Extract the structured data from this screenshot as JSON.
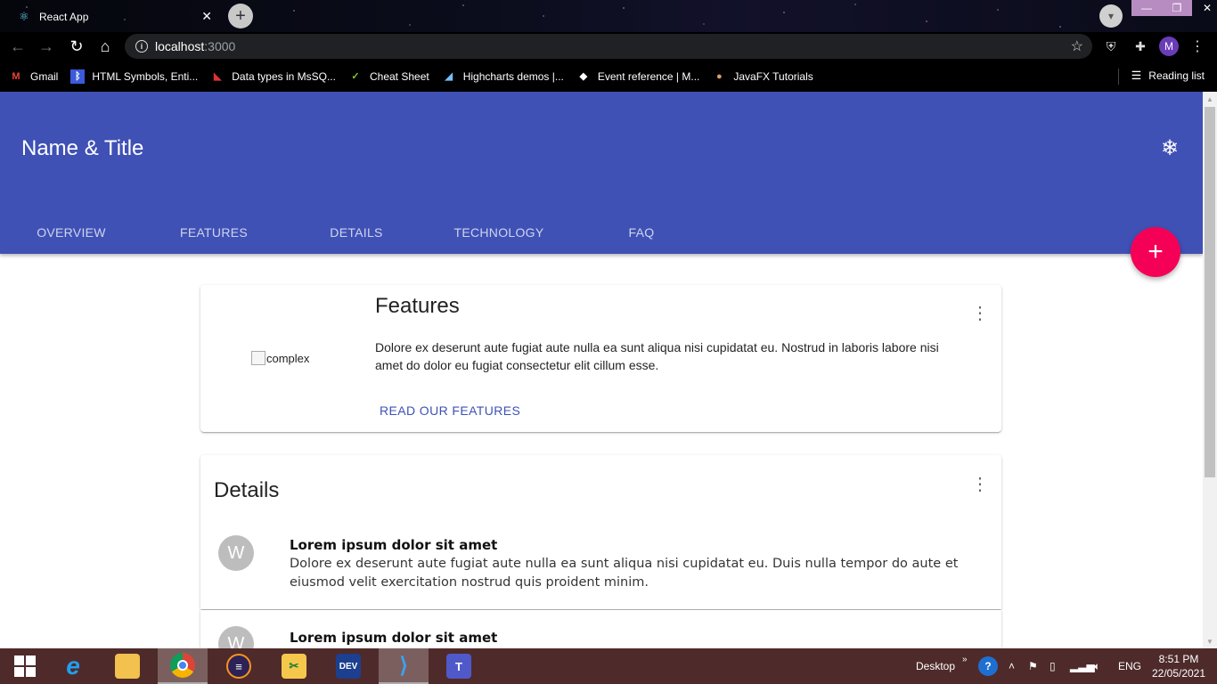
{
  "browser": {
    "tab_title": "React App",
    "tab_close": "✕",
    "new_tab": "+",
    "url_host": "localhost",
    "url_port": ":3000",
    "bookmarks": [
      {
        "label": "Gmail",
        "icon": "gmail-icon",
        "glyph": "M",
        "color": "#ea4335"
      },
      {
        "label": "HTML Symbols, Enti...",
        "icon": "bluetooth-icon",
        "glyph": "ᛒ",
        "color": "#3b5bdb"
      },
      {
        "label": "Data types in MsSQ...",
        "icon": "red-logo-icon",
        "glyph": "◣",
        "color": "#e03131"
      },
      {
        "label": "Cheat Sheet",
        "icon": "cheatsheet-icon",
        "glyph": "✓",
        "color": "#82c91e"
      },
      {
        "label": "Highcharts demos |...",
        "icon": "highcharts-icon",
        "glyph": "◢",
        "color": "#74c0fc"
      },
      {
        "label": "Event reference | M...",
        "icon": "mdn-icon",
        "glyph": "◆",
        "color": "#ffffff"
      },
      {
        "label": "JavaFX Tutorials",
        "icon": "javafx-icon",
        "glyph": "●",
        "color": "#d9a066"
      }
    ],
    "reading_list": "Reading list"
  },
  "app": {
    "title": "Name & Title",
    "tabs": [
      "OVERVIEW",
      "FEATURES",
      "DETAILS",
      "TECHNOLOGY",
      "FAQ"
    ],
    "fab_label": "+",
    "primary_color": "#3f51b5",
    "accent_color": "#f50057"
  },
  "features_card": {
    "image_alt": "complex",
    "title": "Features",
    "body": "Dolore ex deserunt aute fugiat aute nulla ea sunt aliqua nisi cupidatat eu. Nostrud in laboris labore nisi amet do dolor eu fugiat consectetur elit cillum esse.",
    "link": "READ OUR FEATURES"
  },
  "details_card": {
    "title": "Details",
    "items": [
      {
        "avatar": "W",
        "title": "Lorem ipsum dolor sit amet",
        "text": "Dolore ex deserunt aute fugiat aute nulla ea sunt aliqua nisi cupidatat eu. Duis nulla tempor do aute et eiusmod velit exercitation nostrud quis proident minim."
      },
      {
        "avatar": "W",
        "title": "Lorem ipsum dolor sit amet"
      }
    ]
  },
  "taskbar": {
    "desktop_label": "Desktop",
    "language": "ENG",
    "time": "8:51 PM",
    "date": "22/05/2021",
    "apps": [
      "internet-explorer-icon",
      "file-explorer-icon",
      "chrome-icon",
      "eclipse-icon",
      "snipping-tool-icon",
      "devcpp-icon",
      "vscode-icon",
      "teams-icon"
    ]
  }
}
